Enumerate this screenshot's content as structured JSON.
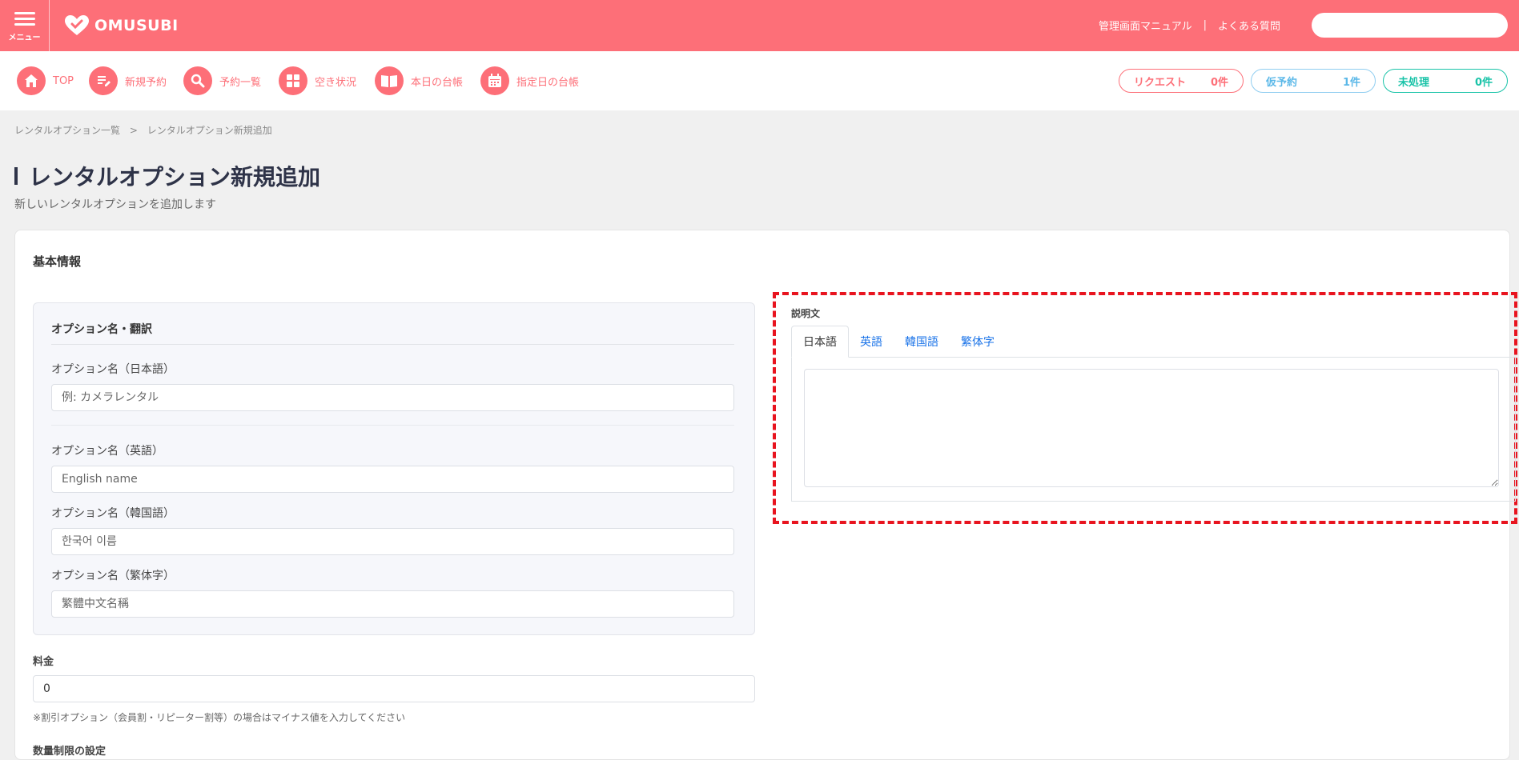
{
  "header": {
    "menu_label": "メニュー",
    "logo_text": "OMUSUBI",
    "links": [
      "管理画面マニュアル",
      "よくある質問"
    ],
    "search_placeholder": ""
  },
  "nav": {
    "items": [
      {
        "label": "TOP",
        "icon": "home-icon"
      },
      {
        "label": "新規予約",
        "icon": "edit-list-icon"
      },
      {
        "label": "予約一覧",
        "icon": "search-icon"
      },
      {
        "label": "空き状況",
        "icon": "grid-icon"
      },
      {
        "label": "本日の台帳",
        "icon": "book-icon"
      },
      {
        "label": "指定日の台帳",
        "icon": "calendar-icon"
      }
    ],
    "status_pills": [
      {
        "label": "リクエスト",
        "count": "0件",
        "color": "#fd6f78"
      },
      {
        "label": "仮予約",
        "count": "1件",
        "color": "#5bb8e8"
      },
      {
        "label": "未処理",
        "count": "0件",
        "color": "#19c3a8"
      }
    ]
  },
  "breadcrumb": [
    "レンタルオプション一覧",
    "レンタルオプション新規追加"
  ],
  "breadcrumb_sep": ">",
  "page": {
    "title": "レンタルオプション新規追加",
    "subtitle": "新しいレンタルオプションを追加します"
  },
  "form": {
    "section_title": "基本情報",
    "names_panel_title": "オプション名・翻訳",
    "fields": [
      {
        "label": "オプション名（日本語）",
        "placeholder": "例: カメラレンタル",
        "value": ""
      },
      {
        "label": "オプション名（英語）",
        "placeholder": "English name",
        "value": ""
      },
      {
        "label": "オプション名（韓国語）",
        "placeholder": "한국어 이름",
        "value": ""
      },
      {
        "label": "オプション名（繁体字）",
        "placeholder": "繁體中文名稱",
        "value": ""
      }
    ],
    "description": {
      "label": "説明文",
      "tabs": [
        "日本語",
        "英語",
        "韓国語",
        "繁体字"
      ],
      "active_tab": "日本語",
      "value": ""
    },
    "price": {
      "label": "料金",
      "value": "0",
      "note": "※割引オプション（会員割・リピーター割等）の場合はマイナス値を入力してください"
    },
    "quantity_limit_label": "数量制限の設定"
  },
  "colors": {
    "brand": "#fd6f78",
    "highlight": "#e8141f",
    "link": "#1a73e8"
  }
}
